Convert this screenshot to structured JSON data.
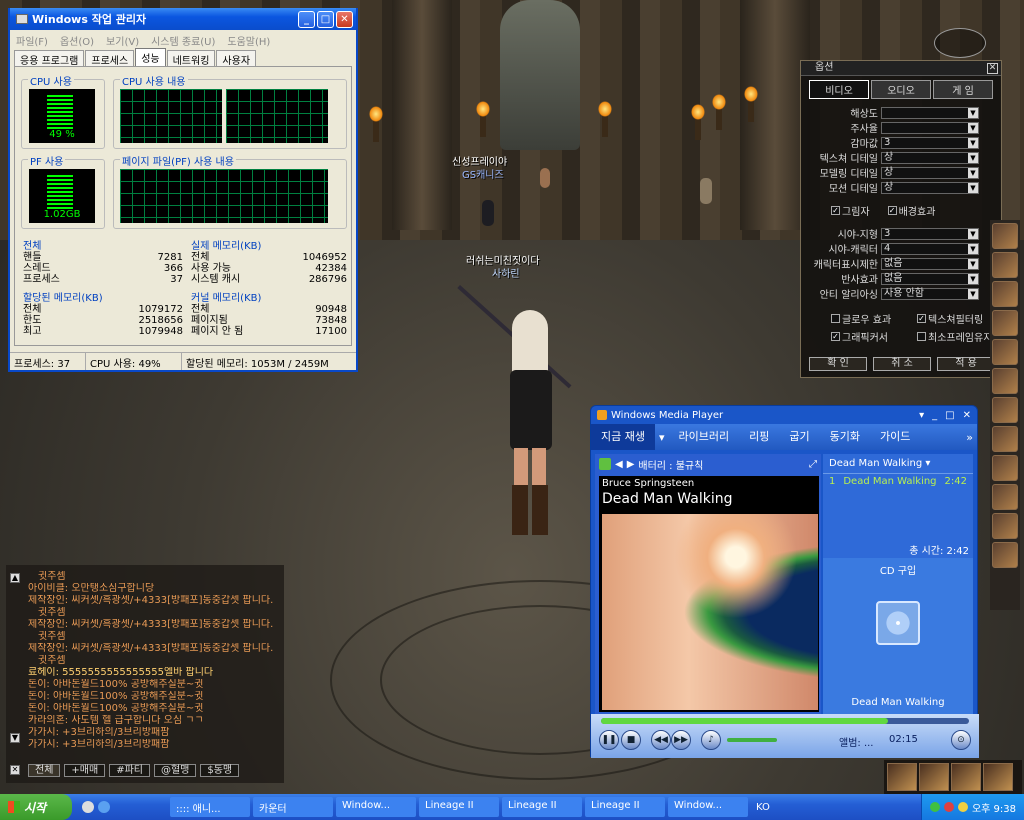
{
  "taskmgr": {
    "title": "Windows 작업 관리자",
    "menu": [
      "파일(F)",
      "옵션(O)",
      "보기(V)",
      "시스템 종료(U)",
      "도움말(H)"
    ],
    "tabs": [
      "응용 프로그램",
      "프로세스",
      "성능",
      "네트워킹",
      "사용자"
    ],
    "cpu_usage_label": "CPU 사용",
    "cpu_usage_value": "49 %",
    "cpu_history_label": "CPU 사용 내용",
    "pf_label": "PF 사용",
    "pf_value": "1.02GB",
    "pf_history_label": "페이지 파일(PF) 사용 내용",
    "totals": {
      "title": "전체",
      "rows": [
        [
          "핸들",
          "7281"
        ],
        [
          "스레드",
          "366"
        ],
        [
          "프로세스",
          "37"
        ]
      ]
    },
    "physical": {
      "title": "실제 메모리(KB)",
      "rows": [
        [
          "전체",
          "1046952"
        ],
        [
          "사용 가능",
          "42384"
        ],
        [
          "시스템 캐시",
          "286796"
        ]
      ]
    },
    "commit": {
      "title": "할당된 메모리(KB)",
      "rows": [
        [
          "전체",
          "1079172"
        ],
        [
          "한도",
          "2518656"
        ],
        [
          "최고",
          "1079948"
        ]
      ]
    },
    "kernel": {
      "title": "커널 메모리(KB)",
      "rows": [
        [
          "전체",
          "90948"
        ],
        [
          "페이지됨",
          "73848"
        ],
        [
          "페이지 안 됨",
          "17100"
        ]
      ]
    },
    "status": {
      "processes": "프로세스: 37",
      "cpu": "CPU 사용: 49%",
      "commit": "할당된 메모리: 1053M / 2459M"
    },
    "cpu_percent": 49
  },
  "game": {
    "npc1_title": "신성프레이야",
    "npc1_name": "GS캐니즈",
    "npc2_title": "러쉬는미친짓이다",
    "npc2_name": "사하린"
  },
  "options": {
    "title": "옵션",
    "tabs": [
      "비디오",
      "오디오",
      "게 임"
    ],
    "rows1": [
      [
        "해상도",
        ""
      ],
      [
        "주사율",
        ""
      ],
      [
        "감마값",
        "3"
      ],
      [
        "텍스쳐 디테일",
        "상"
      ],
      [
        "모델링 디테일",
        "상"
      ],
      [
        "모션 디테일",
        "상"
      ]
    ],
    "chk1": [
      "그림자",
      "배경효과"
    ],
    "rows2": [
      [
        "시야-지형",
        "3"
      ],
      [
        "시야-캐릭터",
        "4"
      ],
      [
        "캐릭터표시제한",
        "없음"
      ],
      [
        "반사효과",
        "없음"
      ],
      [
        "안티 알리아싱",
        "사용 안함"
      ]
    ],
    "chk2": [
      "글로우 효과",
      "텍스쳐필터링",
      "그래픽커서",
      "최소프레임유지"
    ],
    "buttons": [
      "확 인",
      "취 소",
      "적 용"
    ]
  },
  "wmp": {
    "title": "Windows Media Player",
    "tabs": [
      "지금 재생",
      "라이브러리",
      "리핑",
      "굽기",
      "동기화",
      "가이드"
    ],
    "subbar": "배터리 : 불규칙",
    "artist": "Bruce Springsteen",
    "song": "Dead Man Walking",
    "playlist_title": "Dead Man Walking",
    "playlist": [
      {
        "num": "1",
        "title": "Dead Man Walking",
        "time": "2:42"
      }
    ],
    "total_time": "총 시간: 2:42",
    "buy_cd": "CD 구입",
    "album_caption": "Dead Man Walking",
    "album_label": "앨범: ...",
    "time": "02:15",
    "progress": 0.78
  },
  "chat": {
    "lines": [
      {
        "t": "귓주셈",
        "y": false
      },
      {
        "t": "아이비클: 오만탱소심구합니당",
        "y": false
      },
      {
        "t": "제작장인: 씨커셋/흑광셋/+4333[방패포]동중갑셋 팝니다.",
        "y": false
      },
      {
        "t": "귓주셈",
        "y": false
      },
      {
        "t": "제작장인: 씨커셋/흑광셋/+4333[방패포]동중갑셋 팝니다.",
        "y": false
      },
      {
        "t": "귓주셈",
        "y": false
      },
      {
        "t": "제작장인: 씨커셋/흑광셋/+4333[방패포]동중갑셋 팝니다.",
        "y": false
      },
      {
        "t": "귓주셈",
        "y": false
      },
      {
        "t": "료헤이: 5555555555555555엘바 팝니다",
        "y": true
      },
      {
        "t": "돈이: 아바돈월드100% 공방해주실분~귓",
        "y": false
      },
      {
        "t": "돈이: 아바돈월드100% 공방해주실분~귓",
        "y": false
      },
      {
        "t": "돈이: 아바돈월드100% 공방해주실분~귓",
        "y": false
      },
      {
        "t": "카라의혼: 사도템 헬 급구합니다 오심 ㄱㄱ",
        "y": false
      },
      {
        "t": "가가시: +3브리하의/3브리방패팜",
        "y": false
      },
      {
        "t": "가가시: +3브리하의/3브리방패팜",
        "y": false
      }
    ],
    "tabs": [
      "전체",
      "+매매",
      "#파티",
      "@혈맹",
      "$동맹"
    ]
  },
  "taskbar": {
    "start": "시작",
    "tasks": [
      ":::: 애니...",
      "카운터",
      "Window...",
      "Lineage II",
      "Lineage II",
      "Lineage II",
      "Window..."
    ],
    "lang": "KO",
    "clock": "오후 9:38"
  }
}
